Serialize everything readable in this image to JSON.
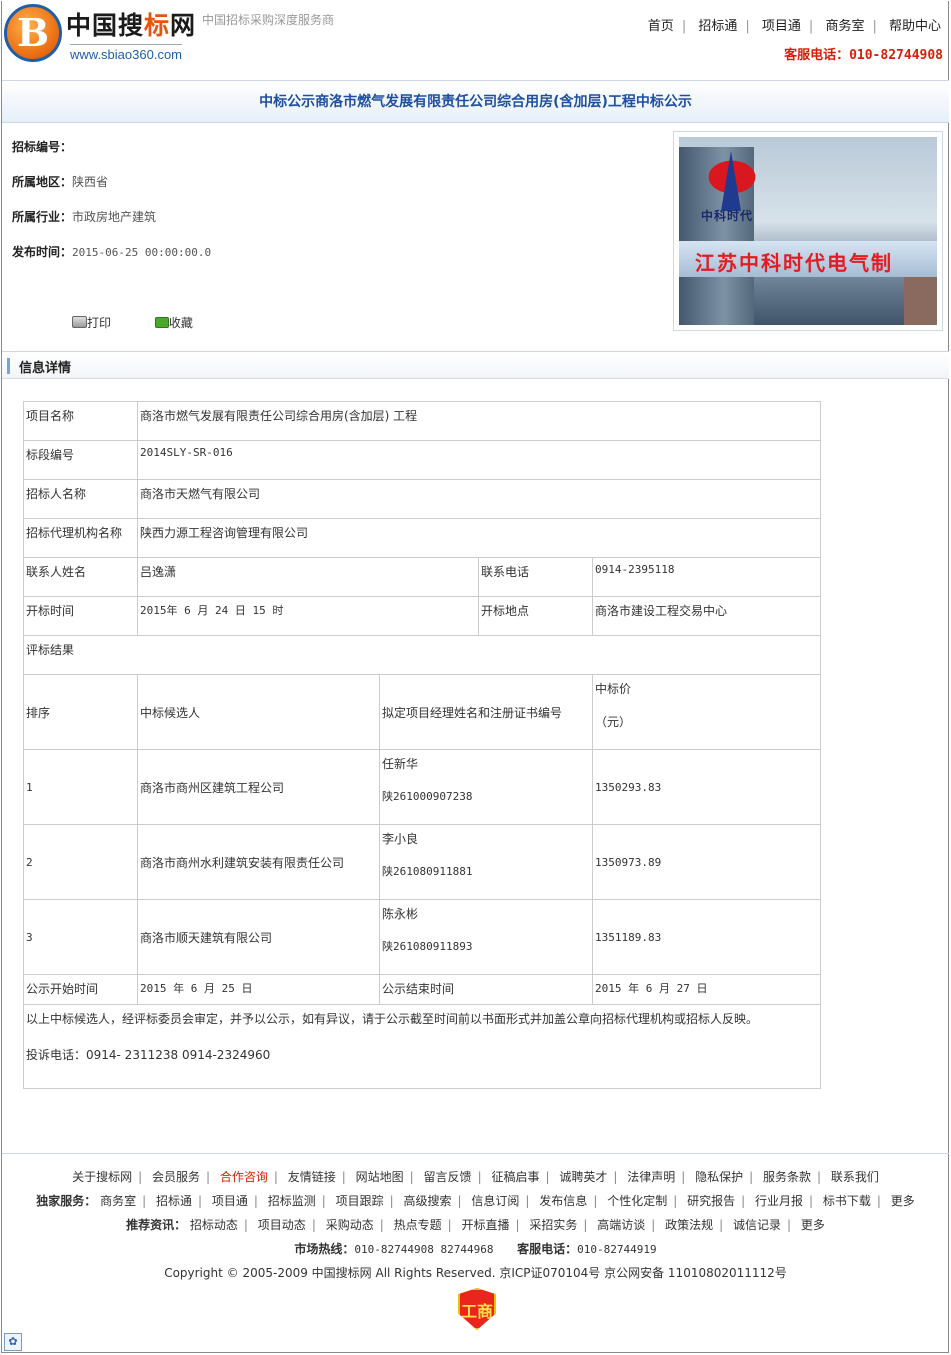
{
  "header": {
    "logo_letter": "B",
    "site_name_part1": "中国搜",
    "site_name_accent": "标",
    "site_name_part2": "网",
    "site_url": "www.sbiao360.com",
    "slogan": "中国招标采购深度服务商",
    "nav": [
      "首页",
      "招标通",
      "项目通",
      "商务室",
      "帮助中心"
    ],
    "hotline": "客服电话：010-82744908"
  },
  "title": "中标公示商洛市燃气发展有限责任公司综合用房(含加层)工程中标公示",
  "meta": {
    "bid_no_label": "招标编号：",
    "bid_no_value": "",
    "region_label": "所属地区：",
    "region_value": "陕西省",
    "industry_label": "所属行业：",
    "industry_value": "市政房地产建筑",
    "pub_time_label": "发布时间：",
    "pub_time_value": "2015-06-25 00:00:00.0"
  },
  "actions": {
    "print": "打印",
    "favorite": "收藏"
  },
  "ad": {
    "brand": "中科时代",
    "text": "江苏中科时代电气制"
  },
  "section_title": "信息详情",
  "detail": {
    "project_name_label": "项目名称",
    "project_name": "商洛市燃气发展有限责任公司综合用房(含加层) 工程",
    "section_no_label": "标段编号",
    "section_no": "2014SLY-SR-016",
    "tenderer_label": "招标人名称",
    "tenderer": "商洛市天燃气有限公司",
    "agency_label": "招标代理机构名称",
    "agency": "陕西力源工程咨询管理有限公司",
    "contact_label": "联系人姓名",
    "contact": "吕逸潇",
    "phone_label": "联系电话",
    "phone": "0914-2395118",
    "open_time_label": "开标时间",
    "open_time": "2015年 6 月 24 日 15 时",
    "open_place_label": "开标地点",
    "open_place": "商洛市建设工程交易中心",
    "result_label": "评标结果",
    "columns": {
      "rank": "排序",
      "candidate": "中标候选人",
      "manager": "拟定项目经理姓名和注册证书编号",
      "price_line1": "中标价",
      "price_line2": "（元）"
    },
    "rows": [
      {
        "rank": "1",
        "candidate": "商洛市商州区建筑工程公司",
        "manager_name": "任新华",
        "manager_cert": "陕261000907238",
        "price": "1350293.83"
      },
      {
        "rank": "2",
        "candidate": "商洛市商州水利建筑安装有限责任公司",
        "manager_name": "李小良",
        "manager_cert": "陕261080911881",
        "price": "1350973.89"
      },
      {
        "rank": "3",
        "candidate": "商洛市顺天建筑有限公司",
        "manager_name": "陈永彬",
        "manager_cert": "陕261080911893",
        "price": "1351189.83"
      }
    ],
    "notice_start_label": "公示开始时间",
    "notice_start": "2015 年 6 月 25 日",
    "notice_end_label": "公示结束时间",
    "notice_end": "2015 年 6 月 27 日",
    "note": "以上中标候选人，经评标委员会审定，并予以公示，如有异议，请于公示截至时间前以书面形式并加盖公章向招标代理机构或招标人反映。",
    "complaint": "投诉电话：0914- 2311238 0914-2324960"
  },
  "footer": {
    "links": [
      "关于搜标网",
      "会员服务",
      "合作咨询",
      "友情链接",
      "网站地图",
      "留言反馈",
      "征稿启事",
      "诚聘英才",
      "法律声明",
      "隐私保护",
      "服务条款",
      "联系我们"
    ],
    "exclusive_label": "独家服务：",
    "exclusive": [
      "商务室",
      "招标通",
      "项目通",
      "招标监测",
      "项目跟踪",
      "高级搜索",
      "信息订阅",
      "发布信息",
      "个性化定制",
      "研究报告",
      "行业月报",
      "标书下载",
      "更多"
    ],
    "recommend_label": "推荐资讯：",
    "recommend": [
      "招标动态",
      "项目动态",
      "采购动态",
      "热点专题",
      "开标直播",
      "采招实务",
      "高端访谈",
      "政策法规",
      "诚信记录",
      "更多"
    ],
    "market_label": "市场热线：",
    "market_value": "010-82744908  82744968",
    "service_label": "客服电话：",
    "service_value": "010-82744919",
    "copyright": "Copyright © 2005-2009 中国搜标网  All Rights Reserved. 京ICP证070104号  京公网安备  11010802011112号",
    "badge": "工商"
  }
}
